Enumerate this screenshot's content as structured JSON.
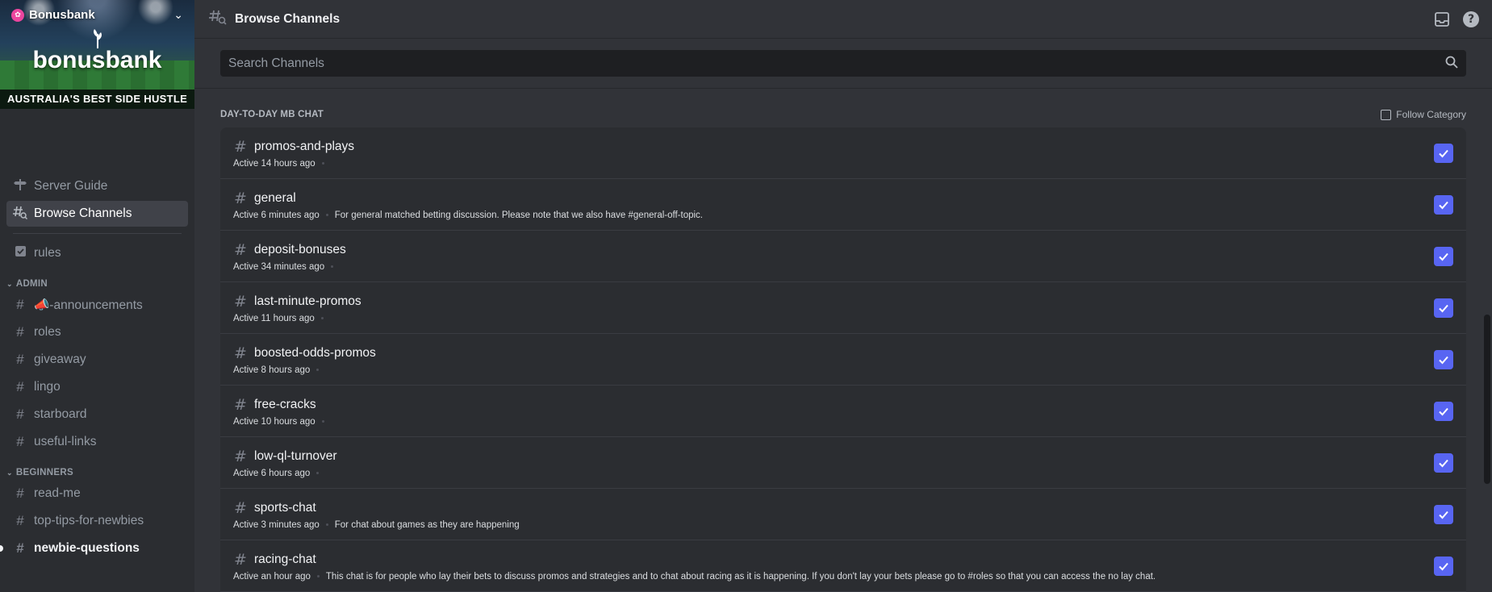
{
  "server": {
    "name": "Bonusbank",
    "banner_logo": "bonusbank",
    "banner_tagline": "AUSTRALIA'S BEST SIDE HUSTLE"
  },
  "sidebar": {
    "top_items": [
      {
        "label": "Server Guide",
        "icon": "signpost-icon"
      },
      {
        "label": "Browse Channels",
        "icon": "browse-channels-icon",
        "active": true
      }
    ],
    "rules": {
      "label": "rules",
      "icon": "rules-checkbox-icon"
    },
    "categories": [
      {
        "name": "ADMIN",
        "channels": [
          "📣-announcements",
          "roles",
          "giveaway",
          "lingo",
          "starboard",
          "useful-links"
        ]
      },
      {
        "name": "BEGINNERS",
        "channels": [
          "read-me",
          "top-tips-for-newbies",
          "newbie-questions"
        ]
      }
    ]
  },
  "topbar": {
    "title": "Browse Channels",
    "icons": [
      "inbox-icon",
      "help-icon"
    ]
  },
  "search": {
    "placeholder": "Search Channels"
  },
  "category": {
    "title": "DAY-TO-DAY MB CHAT",
    "follow_label": "Follow Category",
    "follow_checked": false
  },
  "channels": [
    {
      "name": "promos-and-plays",
      "activity": "Active 14 hours ago",
      "description": "",
      "followed": true
    },
    {
      "name": "general",
      "activity": "Active 6 minutes ago",
      "description": "For general matched betting discussion. Please note that we also have #general-off-topic.",
      "followed": true
    },
    {
      "name": "deposit-bonuses",
      "activity": "Active 34 minutes ago",
      "description": "",
      "followed": true
    },
    {
      "name": "last-minute-promos",
      "activity": "Active 11 hours ago",
      "description": "",
      "followed": true
    },
    {
      "name": "boosted-odds-promos",
      "activity": "Active 8 hours ago",
      "description": "",
      "followed": true
    },
    {
      "name": "free-cracks",
      "activity": "Active 10 hours ago",
      "description": "",
      "followed": true
    },
    {
      "name": "low-ql-turnover",
      "activity": "Active 6 hours ago",
      "description": "",
      "followed": true
    },
    {
      "name": "sports-chat",
      "activity": "Active 3 minutes ago",
      "description": "For chat about games as they are happening",
      "followed": true
    },
    {
      "name": "racing-chat",
      "activity": "Active an hour ago",
      "description": "This chat is for people who lay their bets to discuss promos and strategies and to chat about racing as it is happening. If you don't lay your bets please go to #roles so that you can access the no lay chat.",
      "followed": true
    }
  ],
  "colors": {
    "accent": "#5865f2",
    "sidebar_bg": "#2b2d31",
    "main_bg": "#313338"
  }
}
